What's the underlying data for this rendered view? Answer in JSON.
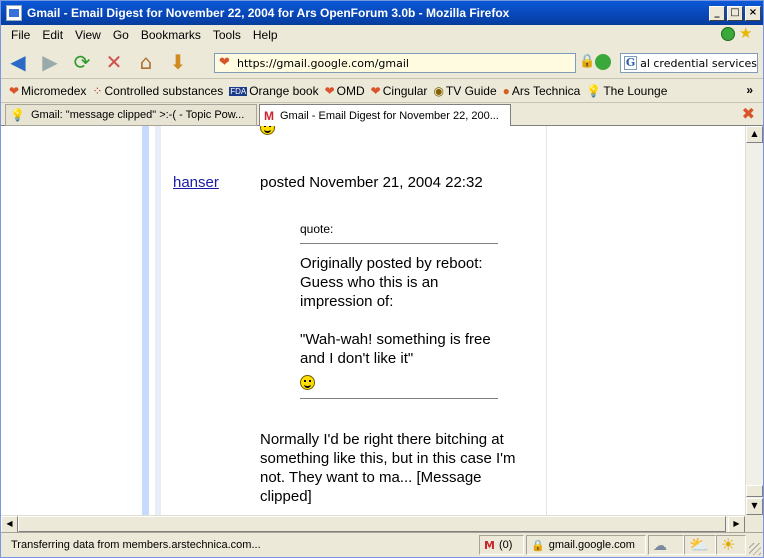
{
  "window": {
    "title": "Gmail - Email Digest for November 22, 2004 for Ars OpenForum 3.0b - Mozilla Firefox",
    "buttons": {
      "minimize": "_",
      "maximize": "□",
      "close": "×"
    }
  },
  "menu": {
    "items": [
      "File",
      "Edit",
      "View",
      "Go",
      "Bookmarks",
      "Tools",
      "Help"
    ]
  },
  "toolbar": {
    "url": "https://gmail.google.com/gmail",
    "search_value": "al credential services"
  },
  "bookmarks": [
    {
      "label": "Micromedex",
      "icon": "heart-icon"
    },
    {
      "label": "Controlled substances",
      "icon": "pill-icon"
    },
    {
      "label": "Orange book",
      "icon": "fda-icon"
    },
    {
      "label": "OMD",
      "icon": "heart-icon"
    },
    {
      "label": "Cingular",
      "icon": "heart-icon"
    },
    {
      "label": "TV Guide",
      "icon": "tv-icon"
    },
    {
      "label": "Ars Technica",
      "icon": "ars-icon"
    },
    {
      "label": "The Lounge",
      "icon": "bulb-icon"
    }
  ],
  "bookmarks_more": "»",
  "tabs": [
    {
      "label": "Gmail: \"message clipped\" >:-( - Topic Pow...",
      "active": false
    },
    {
      "label": "Gmail - Email Digest for November 22, 200...",
      "active": true
    }
  ],
  "post": {
    "author": "hanser",
    "posted": "posted November 21, 2004 22:32",
    "quote_label": "quote:",
    "quote_lines": [
      "Originally posted by reboot:",
      "Guess who this is an",
      "impression of:"
    ],
    "quote_lines_2": [
      "\"Wah-wah! something is free",
      "and I don't like it\""
    ],
    "reply_lines": [
      "Normally I'd be right there bitching at",
      "something like this, but in this case I'm",
      "not. They want to ma... [Message",
      "clipped]"
    ]
  },
  "status": {
    "text": "Transferring data from members.arstechnica.com...",
    "mail_count": "(0)",
    "host": "gmail.google.com"
  },
  "colors": {
    "titlebar": "#0a59d8",
    "link": "#1a1aa6",
    "urlbar_bg": "#fffbe0"
  }
}
